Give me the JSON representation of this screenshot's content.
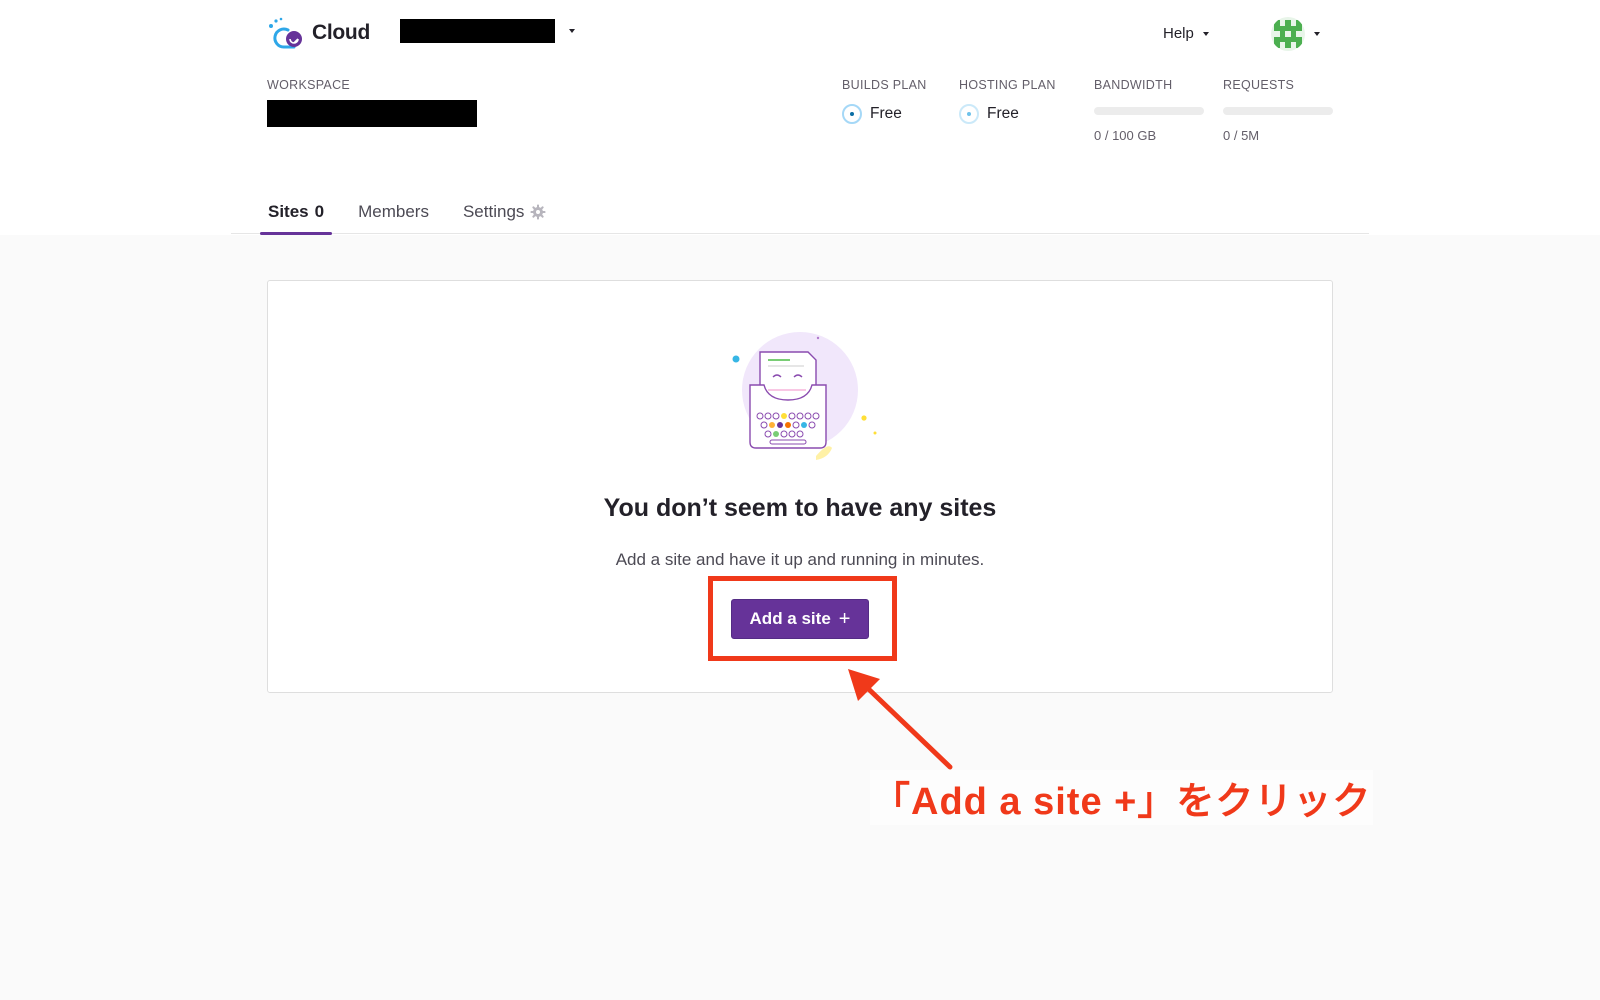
{
  "header": {
    "brand": "Cloud",
    "help_label": "Help"
  },
  "workspace": {
    "label": "WORKSPACE"
  },
  "plans": {
    "builds_label": "BUILDS PLAN",
    "builds_value": "Free",
    "hosting_label": "HOSTING PLAN",
    "hosting_value": "Free"
  },
  "usage": {
    "bandwidth_label": "BANDWIDTH",
    "bandwidth_value": "0 / 100 GB",
    "bandwidth_fraction": 0,
    "requests_label": "REQUESTS",
    "requests_value": "0 / 5M",
    "requests_fraction": 0
  },
  "tabs": [
    {
      "label": "Sites",
      "count": "0",
      "active": true
    },
    {
      "label": "Members",
      "active": false
    },
    {
      "label": "Settings",
      "icon": "gear-icon",
      "active": false
    }
  ],
  "empty_state": {
    "title": "You don’t seem to have any sites",
    "subtitle": "Add a site and have it up and running in minutes.",
    "button_label": "Add a site",
    "button_icon": "plus-icon"
  },
  "annotation": {
    "text": "「Add a site +」をクリック",
    "color": "#f0391a"
  },
  "colors": {
    "accent": "#663399",
    "annotation": "#f0391a"
  }
}
